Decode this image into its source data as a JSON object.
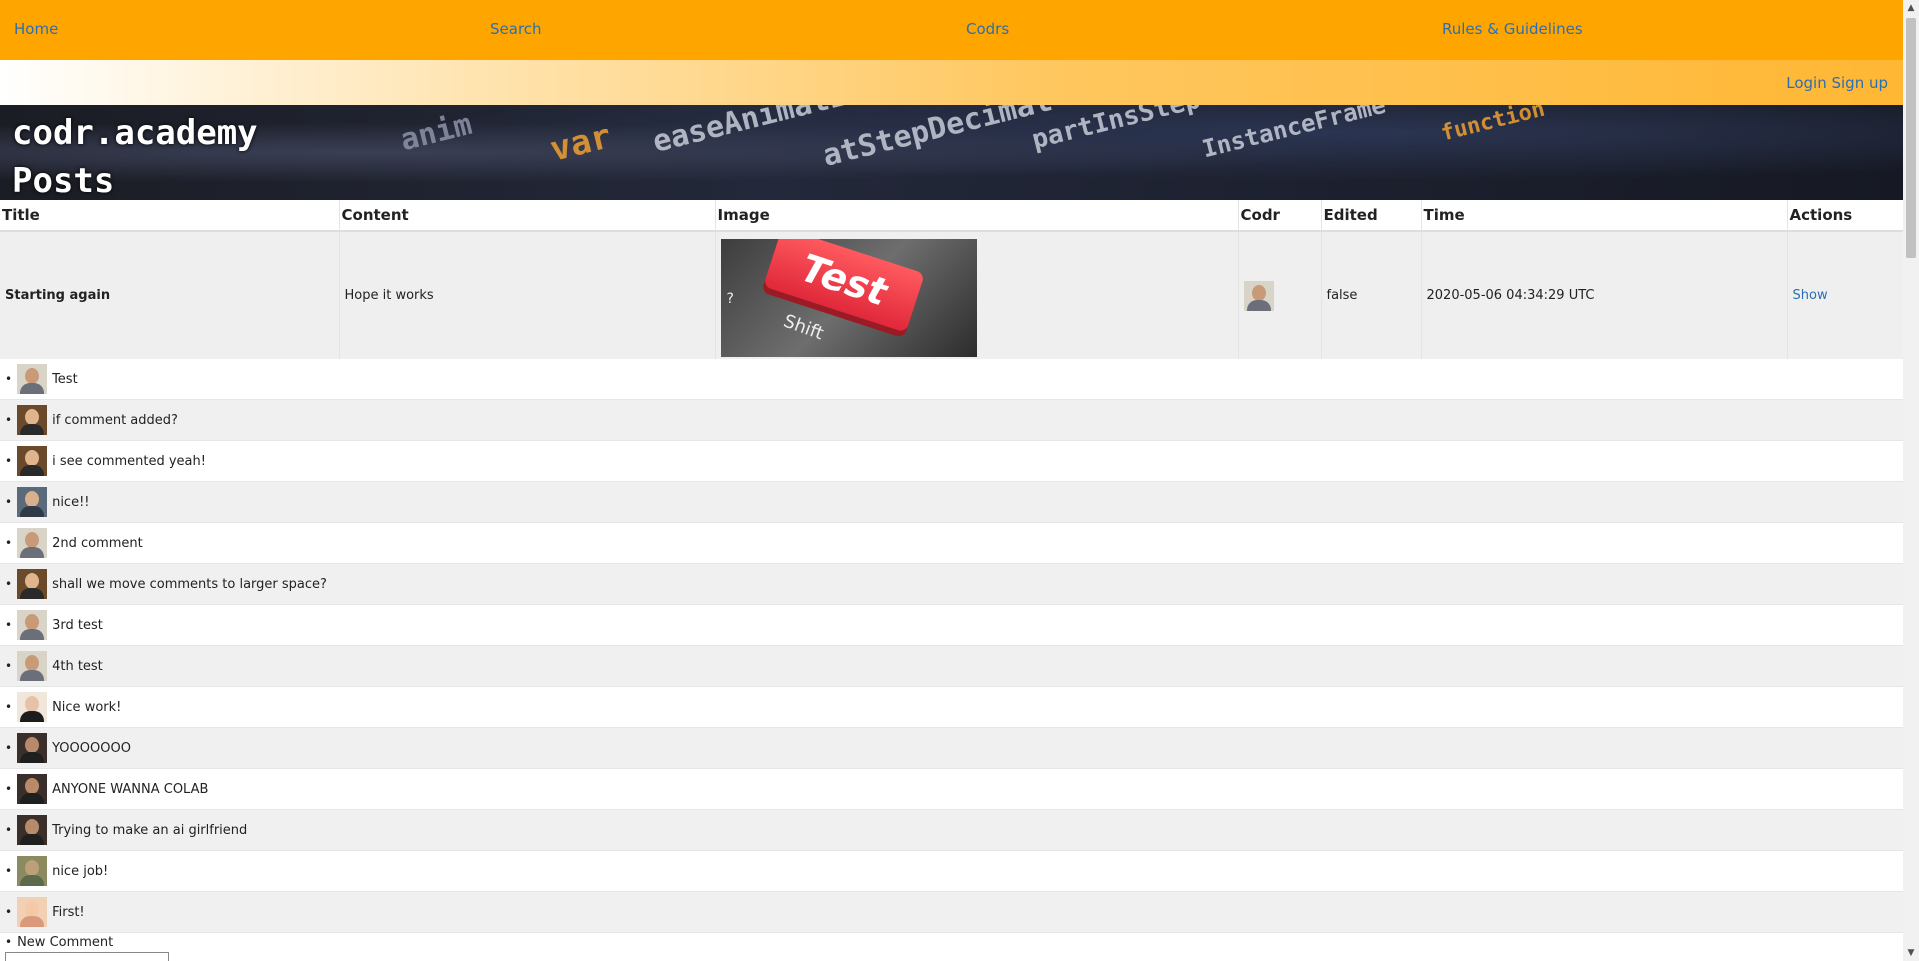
{
  "nav": {
    "home": "Home",
    "search": "Search",
    "codrs": "Codrs",
    "rules": "Rules & Guidelines"
  },
  "auth": {
    "login": "Login",
    "signup": "Sign up"
  },
  "banner": {
    "site_name": "codr.academy",
    "page_title": "Posts"
  },
  "table": {
    "headers": [
      "Title",
      "Content",
      "Image",
      "Codr",
      "Edited",
      "Time",
      "Actions"
    ]
  },
  "post": {
    "title": "Starting again",
    "content": "Hope it works",
    "image_text": "Test",
    "image_key_label": "Shift",
    "image_key_symbol": "?",
    "edited": "false",
    "time": "2020-05-06 04:34:29 UTC",
    "action": "Show"
  },
  "comments": [
    {
      "text": "Test",
      "avatar": "avatar-older-man"
    },
    {
      "text": "if comment added?",
      "avatar": "avatar-woman"
    },
    {
      "text": "i see commented yeah!",
      "avatar": "avatar-woman"
    },
    {
      "text": "nice!!",
      "avatar": "avatar-young-man"
    },
    {
      "text": "2nd comment",
      "avatar": "avatar-older-man"
    },
    {
      "text": "shall we move comments to larger space?",
      "avatar": "avatar-woman"
    },
    {
      "text": "3rd test",
      "avatar": "avatar-older-man"
    },
    {
      "text": "4th test",
      "avatar": "avatar-older-man"
    },
    {
      "text": "Nice work!",
      "avatar": "avatar-dark-hair"
    },
    {
      "text": "YOOOOOOO",
      "avatar": "avatar-bald-man"
    },
    {
      "text": "ANYONE WANNA COLAB",
      "avatar": "avatar-bald-man"
    },
    {
      "text": "Trying to make an ai girlfriend",
      "avatar": "avatar-bald-man"
    },
    {
      "text": "nice job!",
      "avatar": "avatar-outdoor"
    },
    {
      "text": "First!",
      "avatar": "avatar-baby"
    }
  ],
  "new_comment": {
    "label": "New Comment"
  },
  "colors": {
    "nav_bg": "#ffa500",
    "link": "#2a6fb4",
    "row_alt": "#f0f0f0"
  }
}
